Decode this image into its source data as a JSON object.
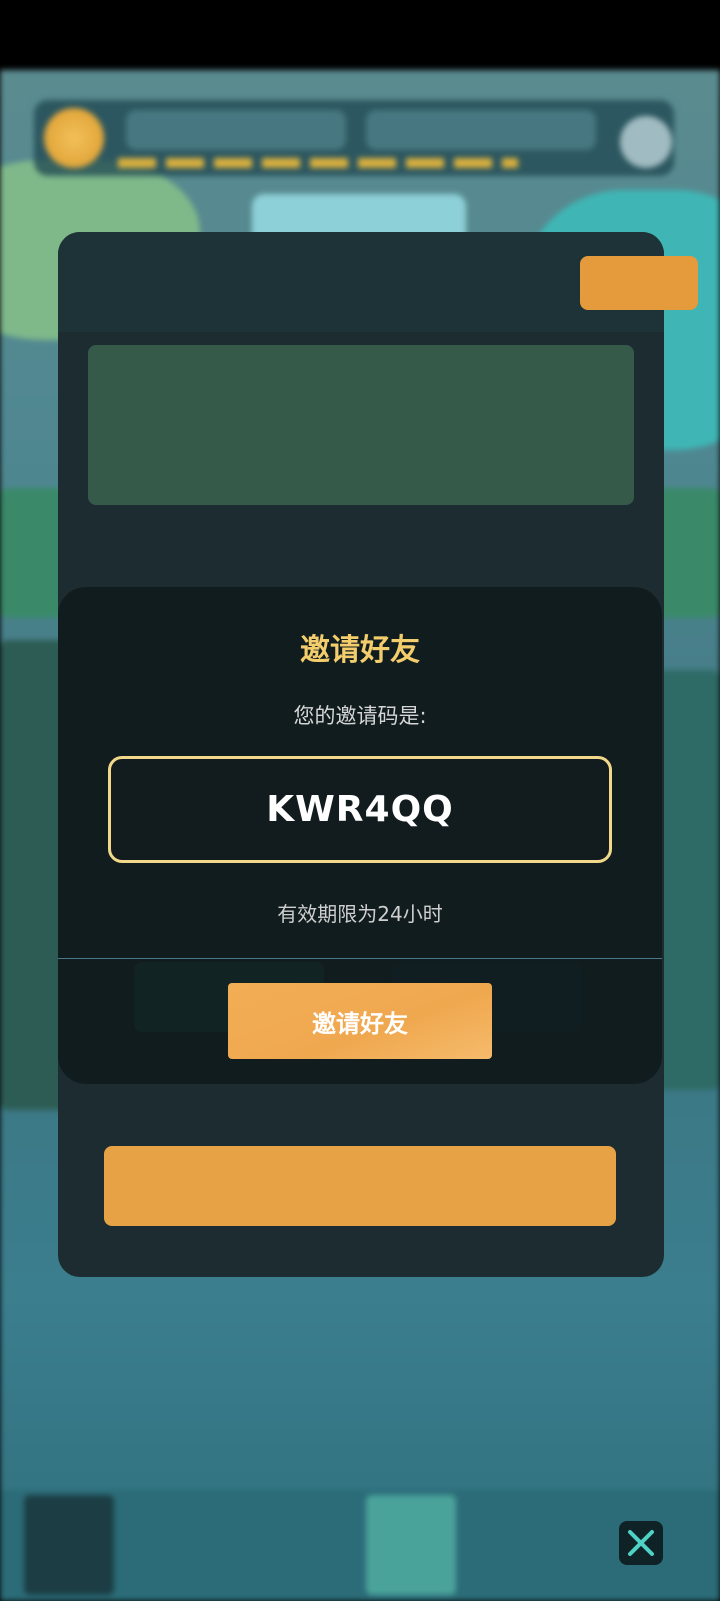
{
  "dialog": {
    "title": "邀请好友",
    "subtitle": "您的邀请码是:",
    "invite_code": "KWR4QQ",
    "validity": "有效期限为24小时",
    "invite_button": "邀请好友"
  },
  "close_button": {
    "icon": "close-icon",
    "color": "#4fd1c5"
  },
  "colors": {
    "title": "#f3cd6b",
    "code_border": "#f1d88a",
    "button": "#f0a84f",
    "divider": "#4b7888"
  }
}
